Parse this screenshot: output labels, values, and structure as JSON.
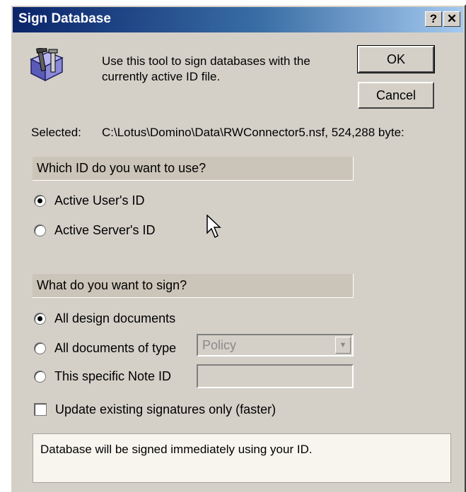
{
  "window": {
    "title": "Sign Database",
    "help_button": "?",
    "close_button": "✕"
  },
  "description": "Use this tool to sign databases with the currently active ID file.",
  "buttons": {
    "ok": "OK",
    "cancel": "Cancel"
  },
  "selected": {
    "label": "Selected:",
    "value": "C:\\Lotus\\Domino\\Data\\RWConnector5.nsf, 524,288 byte:"
  },
  "id_section": {
    "heading": "Which ID do you want to use?",
    "options": [
      {
        "label": "Active User's ID",
        "checked": true
      },
      {
        "label": "Active Server's ID",
        "checked": false
      }
    ]
  },
  "sign_section": {
    "heading": "What do you want to sign?",
    "options": [
      {
        "label": "All design documents",
        "checked": true
      },
      {
        "label": "All documents of type",
        "checked": false
      },
      {
        "label": "This specific Note ID",
        "checked": false
      }
    ],
    "doc_type_value": "Policy",
    "note_id_value": ""
  },
  "update_checkbox": {
    "label": "Update existing signatures only (faster)",
    "checked": false
  },
  "info_text": "Database will be signed immediately using your ID.",
  "icons": {
    "app": "sign-tool-icon",
    "cursor": "mouse-pointer-icon"
  },
  "colors": {
    "titlebar_start": "#0a246a",
    "titlebar_end": "#a6caf0",
    "dialog_bg": "#d4d0c8",
    "section_bg": "#cbc5b9",
    "info_bg": "#f7f5ee"
  }
}
